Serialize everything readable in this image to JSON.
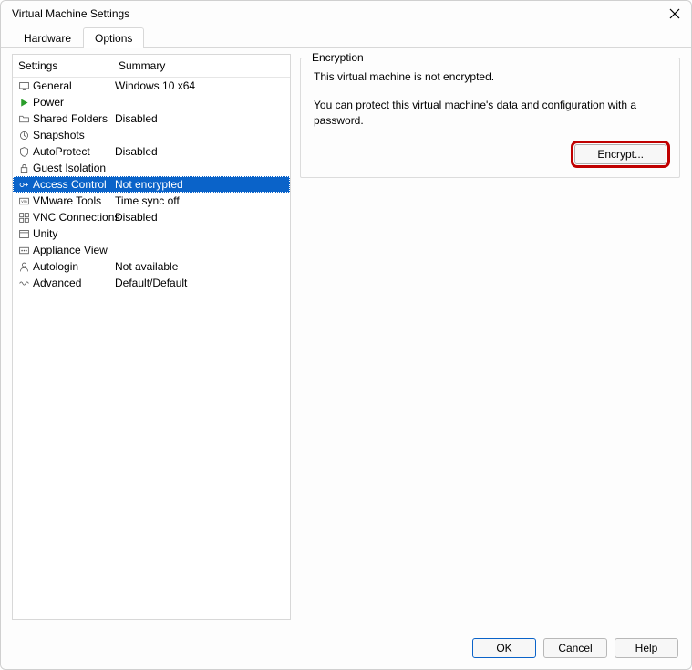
{
  "window": {
    "title": "Virtual Machine Settings"
  },
  "tabs": {
    "hardware": "Hardware",
    "options": "Options"
  },
  "list": {
    "header_settings": "Settings",
    "header_summary": "Summary",
    "rows": [
      {
        "icon": "monitor",
        "label": "General",
        "summary": "Windows 10 x64"
      },
      {
        "icon": "play",
        "label": "Power",
        "summary": ""
      },
      {
        "icon": "folder",
        "label": "Shared Folders",
        "summary": "Disabled"
      },
      {
        "icon": "snapshot",
        "label": "Snapshots",
        "summary": ""
      },
      {
        "icon": "shield",
        "label": "AutoProtect",
        "summary": "Disabled"
      },
      {
        "icon": "lock",
        "label": "Guest Isolation",
        "summary": ""
      },
      {
        "icon": "key",
        "label": "Access Control",
        "summary": "Not encrypted",
        "selected": true
      },
      {
        "icon": "vm",
        "label": "VMware Tools",
        "summary": "Time sync off"
      },
      {
        "icon": "grid",
        "label": "VNC Connections",
        "summary": "Disabled"
      },
      {
        "icon": "window",
        "label": "Unity",
        "summary": ""
      },
      {
        "icon": "appliance",
        "label": "Appliance View",
        "summary": ""
      },
      {
        "icon": "user",
        "label": "Autologin",
        "summary": "Not available"
      },
      {
        "icon": "wave",
        "label": "Advanced",
        "summary": "Default/Default"
      }
    ]
  },
  "encryption": {
    "legend": "Encryption",
    "line1": "This virtual machine is not encrypted.",
    "line2": "You can protect this virtual machine's data and configuration with a password.",
    "button": "Encrypt..."
  },
  "footer": {
    "ok": "OK",
    "cancel": "Cancel",
    "help": "Help"
  }
}
